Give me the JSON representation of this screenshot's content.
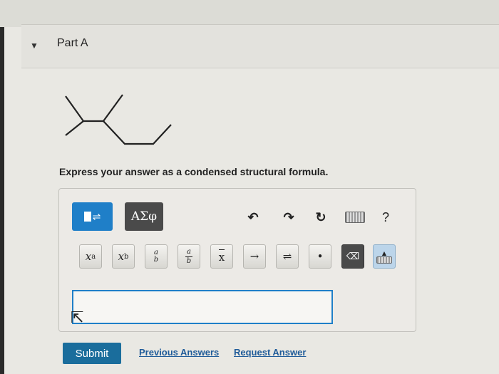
{
  "part": {
    "title": "Part A",
    "caret_icon": "triangle-down-icon"
  },
  "prompt": "Express your answer as a condensed structural formula.",
  "toolbar": {
    "templates_icon": "templates-icon",
    "greek_label": "ΑΣφ",
    "undo_icon": "undo-icon",
    "redo_icon": "redo-icon",
    "reset_icon": "reset-icon",
    "keyboard_icon": "keyboard-icon",
    "help_label": "?"
  },
  "keys": {
    "superscript": "x",
    "superscript_exp": "a",
    "subscript": "x",
    "subscript_idx": "b",
    "frac_num": "a",
    "frac_den": "b",
    "mixed_num": "a",
    "mixed_den": "b",
    "vector_label": "x",
    "arrow_label": "→",
    "equilibrium_label": "⇌",
    "dot_label": "•",
    "backspace_label": "⌫"
  },
  "answer": {
    "value": ""
  },
  "actions": {
    "submit": "Submit",
    "previous_answers": "Previous Answers",
    "request_answer": "Request Answer"
  },
  "colors": {
    "accent": "#1f7fc8",
    "submit_bg": "#1a6d9c",
    "link": "#1f5b99"
  }
}
